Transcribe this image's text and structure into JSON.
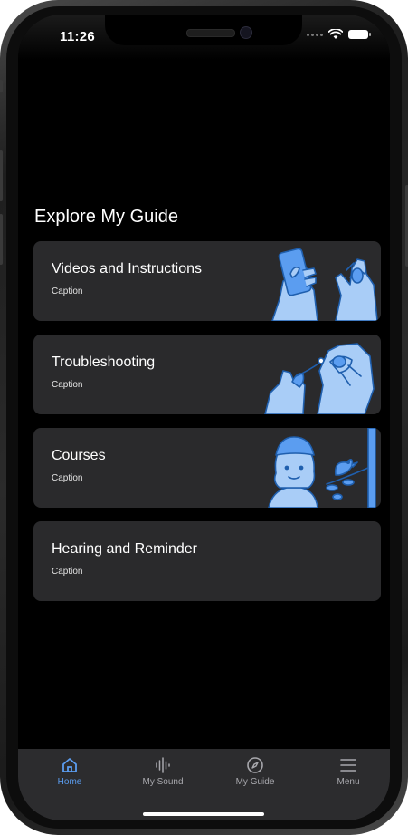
{
  "status_bar": {
    "time": "11:26",
    "icons": [
      "cellular-dots-icon",
      "wifi-icon",
      "battery-icon"
    ]
  },
  "guide": {
    "section_title": "Explore My Guide",
    "cards": [
      {
        "title": "Videos and Instructions",
        "caption": "Caption",
        "illustration": "hands-phone-hearing-aid-illustration"
      },
      {
        "title": "Troubleshooting",
        "caption": "Caption",
        "illustration": "hands-cleaning-hearing-aid-illustration"
      },
      {
        "title": "Courses",
        "caption": "Caption",
        "illustration": "woman-bird-branch-illustration"
      },
      {
        "title": "Hearing and Reminder",
        "caption": "Caption",
        "illustration": ""
      }
    ]
  },
  "tab_bar": {
    "active": "Home",
    "tabs": [
      {
        "label": "Home",
        "icon": "home-icon"
      },
      {
        "label": "My Sound",
        "icon": "sound-wave-icon"
      },
      {
        "label": "My Guide",
        "icon": "compass-icon"
      },
      {
        "label": "Menu",
        "icon": "menu-icon"
      }
    ]
  },
  "colors": {
    "background": "#000000",
    "card": "#2a2a2c",
    "tab_bar": "#2c2c2e",
    "accent": "#5b9df0",
    "illustration_fill": "#a9cdf7",
    "illustration_stroke": "#1f5fae"
  }
}
